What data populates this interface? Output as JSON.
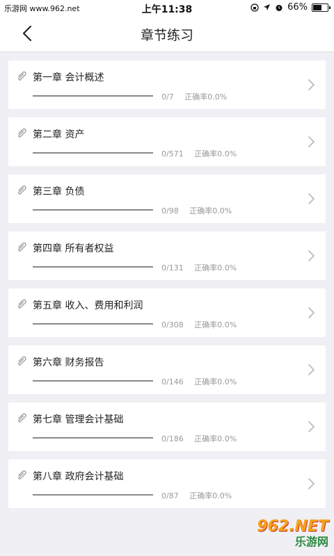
{
  "status_bar": {
    "carrier": "乐游网 www.962.net",
    "time": "上午11:38",
    "battery_percent": "66%",
    "battery_level": 0.66
  },
  "header": {
    "title": "章节练习"
  },
  "chapters": [
    {
      "title": "第一章 会计概述",
      "count": "0/7",
      "accuracy": "正确率0.0%",
      "progress": 0
    },
    {
      "title": "第二章 资产",
      "count": "0/571",
      "accuracy": "正确率0.0%",
      "progress": 0
    },
    {
      "title": "第三章 负债",
      "count": "0/98",
      "accuracy": "正确率0.0%",
      "progress": 0
    },
    {
      "title": "第四章 所有者权益",
      "count": "0/131",
      "accuracy": "正确率0.0%",
      "progress": 0
    },
    {
      "title": "第五章 收入、费用和利润",
      "count": "0/308",
      "accuracy": "正确率0.0%",
      "progress": 0
    },
    {
      "title": "第六章 财务报告",
      "count": "0/146",
      "accuracy": "正确率0.0%",
      "progress": 0
    },
    {
      "title": "第七章 管理会计基础",
      "count": "0/186",
      "accuracy": "正确率0.0%",
      "progress": 0
    },
    {
      "title": "第八章 政府会计基础",
      "count": "0/87",
      "accuracy": "正确率0.0%",
      "progress": 0
    }
  ],
  "watermark": {
    "top": "962.NET",
    "bottom": "乐游网"
  },
  "colors": {
    "accent": "#2f8de4",
    "background": "#efeff4"
  },
  "icons": {
    "back": "chevron-left-icon",
    "chapter": "paperclip-icon",
    "row_arrow": "chevron-right-icon"
  }
}
